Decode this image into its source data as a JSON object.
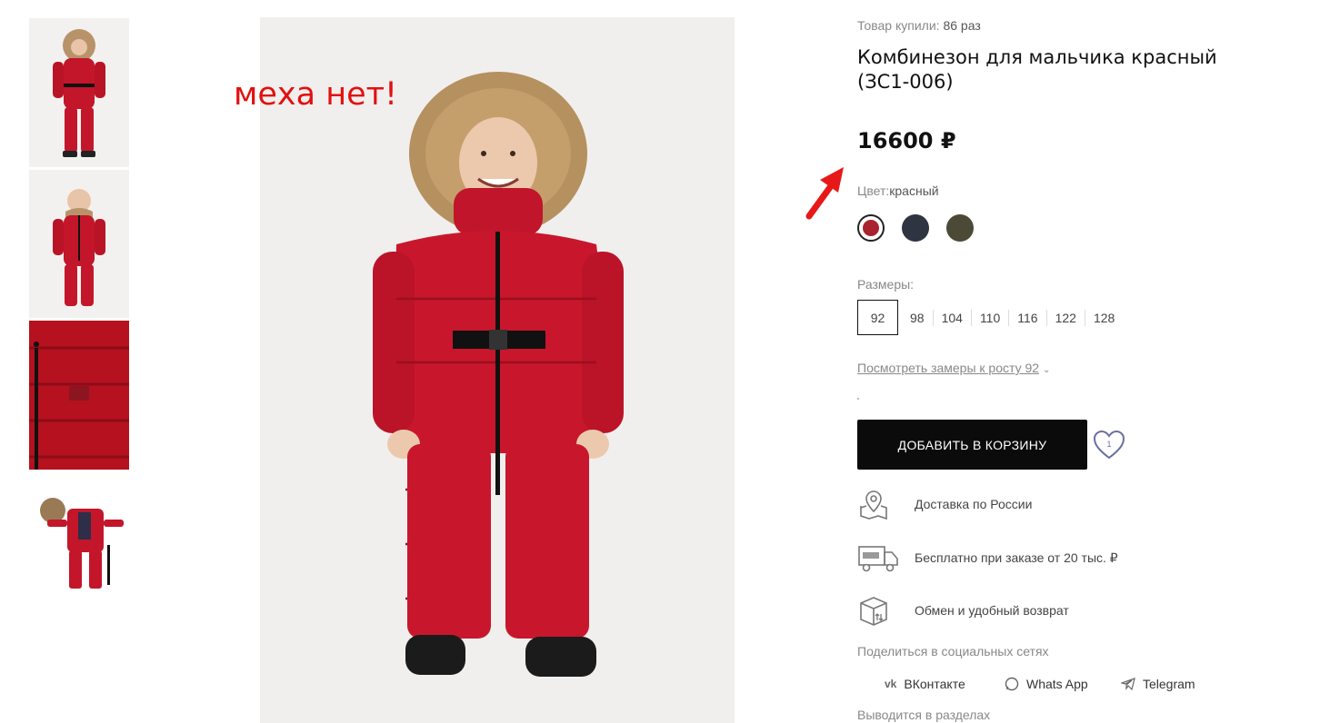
{
  "annotation": {
    "text": "меха нет!",
    "color": "#e21010"
  },
  "product": {
    "purchased_label": "Товар купили:",
    "purchased_count": "86 раз",
    "title": "Комбинезон для мальчика красный (ЗС1-006)",
    "price": "16600 ₽",
    "color_label": "Цвет:",
    "color_value": "красный",
    "colors": [
      {
        "name": "red",
        "hex": "#a8232f",
        "selected": true
      },
      {
        "name": "navy",
        "hex": "#2f3443",
        "selected": false
      },
      {
        "name": "olive",
        "hex": "#4a4a36",
        "selected": false
      }
    ],
    "sizes_label": "Размеры:",
    "sizes": [
      "92",
      "98",
      "104",
      "110",
      "116",
      "122",
      "128"
    ],
    "selected_size": "92",
    "measure_link": "Посмотреть замеры к росту 92",
    "add_to_cart": "ДОБАВИТЬ В КОРЗИНУ",
    "wishlist_count": "1"
  },
  "features": [
    {
      "icon": "map-pin-icon",
      "text": "Доставка по России"
    },
    {
      "icon": "truck-free-icon",
      "text": "Бесплатно при заказе от 20 тыс. ₽"
    },
    {
      "icon": "box-return-icon",
      "text": "Обмен и удобный возврат"
    }
  ],
  "share": {
    "label": "Поделиться в социальных сетях",
    "networks": [
      {
        "icon": "vk-icon",
        "label": "ВКонтакте"
      },
      {
        "icon": "whatsapp-icon",
        "label": "Whats App"
      },
      {
        "icon": "telegram-icon",
        "label": "Telegram"
      }
    ]
  },
  "sections_label": "Выводится в разделах"
}
